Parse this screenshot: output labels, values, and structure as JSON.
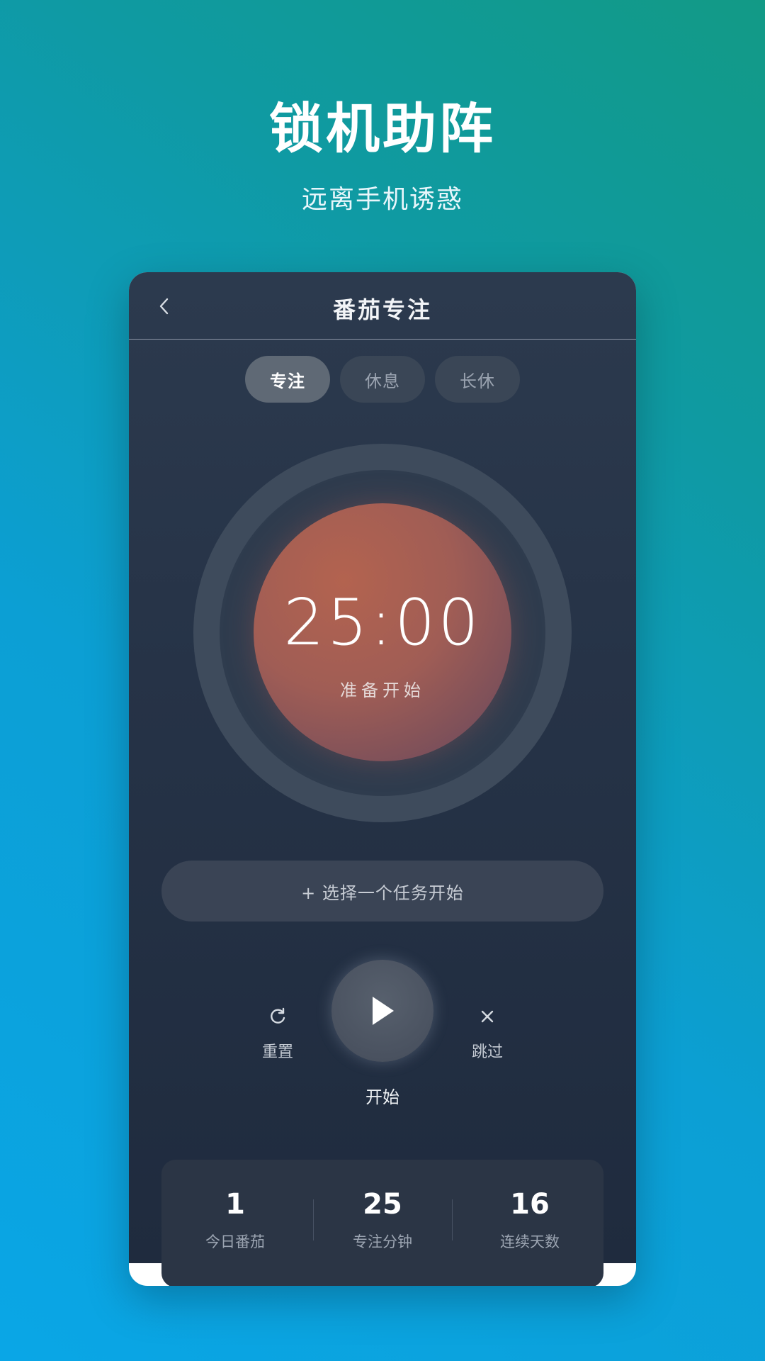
{
  "hero": {
    "title": "锁机助阵",
    "subtitle": "远离手机诱惑"
  },
  "nav": {
    "title": "番茄专注",
    "back_icon": "chevron-left-icon"
  },
  "tabs": [
    {
      "label": "专注",
      "active": true
    },
    {
      "label": "休息",
      "active": false
    },
    {
      "label": "长休",
      "active": false
    }
  ],
  "timer": {
    "time": "25:00",
    "status": "准备开始"
  },
  "task": {
    "label": "+ 选择一个任务开始"
  },
  "controls": {
    "reset_label": "重置",
    "reset_icon": "refresh-icon",
    "play_label": "开始",
    "play_icon": "play-icon",
    "skip_label": "跳过",
    "skip_icon": "close-icon"
  },
  "stats": [
    {
      "value": "1",
      "caption": "今日番茄"
    },
    {
      "value": "25",
      "caption": "专注分钟"
    },
    {
      "value": "16",
      "caption": "连续天数"
    }
  ],
  "colors": {
    "accent_tomato": "#a85e52",
    "screen_bg": "#263347",
    "bg_gradient_start": "#0aa6e6",
    "bg_gradient_end": "#129a86"
  }
}
